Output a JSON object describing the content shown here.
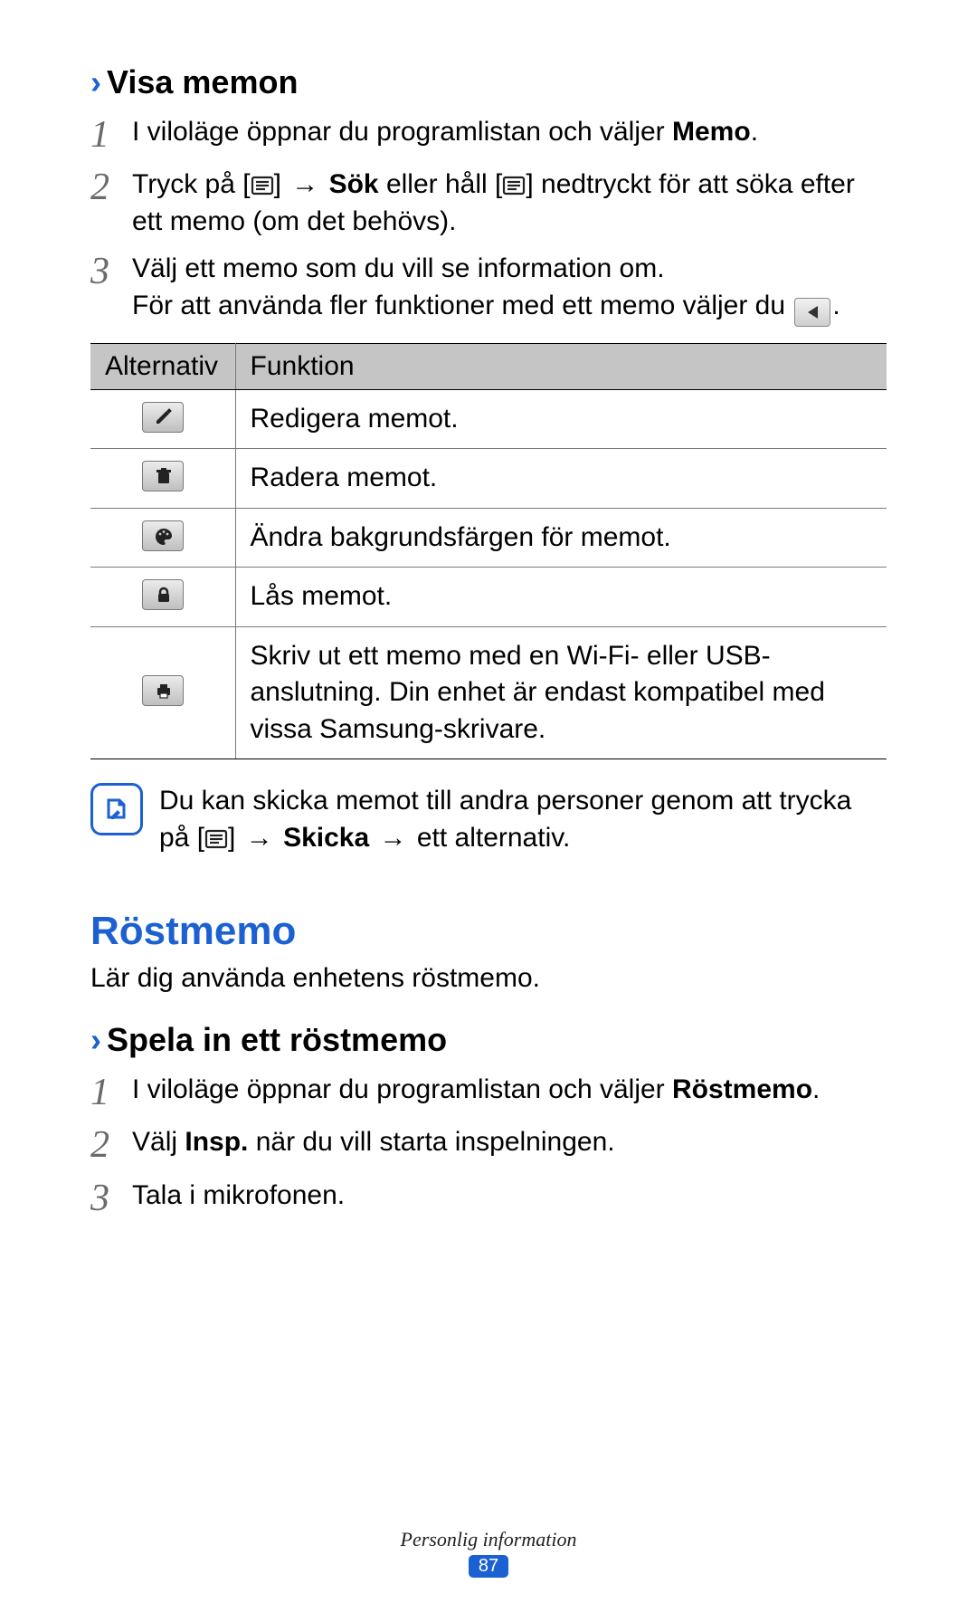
{
  "section1": {
    "title": "Visa memon",
    "steps": [
      {
        "pre": "I viloläge öppnar du programlistan och väljer ",
        "bold": "Memo",
        "post": "."
      },
      {
        "pre1": "Tryck på [",
        "arrow": " → ",
        "bold": "Sök",
        "mid": " eller håll [",
        "post": "] nedtryckt för att söka efter ett memo (om det behövs)."
      },
      {
        "line1": "Välj ett memo som du vill se information om.",
        "line2_pre": "För att använda fler funktioner med ett memo väljer du ",
        "line2_post": "."
      }
    ],
    "table": {
      "head_alt": "Alternativ",
      "head_fn": "Funktion",
      "rows": [
        {
          "icon": "pencil",
          "fn": "Redigera memot."
        },
        {
          "icon": "trash",
          "fn": "Radera memot."
        },
        {
          "icon": "palette",
          "fn": "Ändra bakgrundsfärgen för memot."
        },
        {
          "icon": "lock",
          "fn": "Lås memot."
        },
        {
          "icon": "print",
          "fn": "Skriv ut ett memo med en Wi-Fi- eller USB-anslutning. Din enhet är endast kompatibel med vissa Samsung-skrivare."
        }
      ]
    },
    "note": {
      "pre": "Du kan skicka memot till andra personer genom att trycka på [",
      "arrow": " → ",
      "bold": "Skicka",
      "arrow2": " → ",
      "post": "ett alternativ."
    }
  },
  "section2": {
    "title": "Röstmemo",
    "intro": "Lär dig använda enhetens röstmemo.",
    "sub": "Spela in ett röstmemo",
    "steps": [
      {
        "pre": "I viloläge öppnar du programlistan och väljer ",
        "bold": "Röstmemo",
        "post": "."
      },
      {
        "pre": "Välj ",
        "bold": "Insp.",
        "post": " när du vill starta inspelningen."
      },
      {
        "text": "Tala i mikrofonen."
      }
    ]
  },
  "footer": {
    "chapter": "Personlig information",
    "page": "87"
  }
}
